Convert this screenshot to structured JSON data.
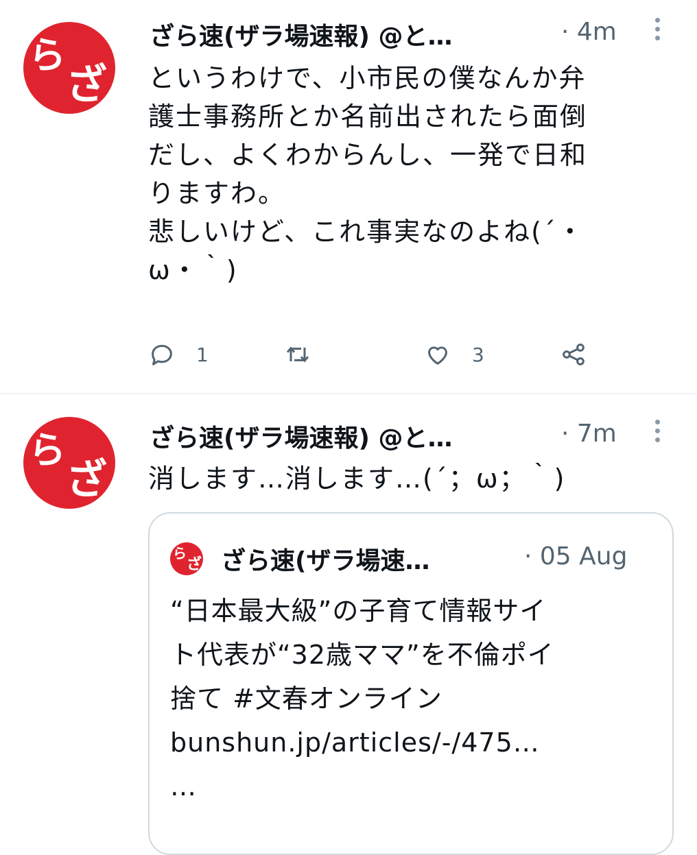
{
  "tweets": [
    {
      "avatar_chars": [
        "ら",
        "ざ"
      ],
      "name": "ざら速(ザラ場速報) @と…",
      "time": "· 4m",
      "body": "というわけで、小市民の僕なんか弁\n護士事務所とか名前出されたら面倒\nだし、よくわからんし、一発で日和\nりますわ。\n悲しいけど、これ事実なのよね(´・\nω・｀)",
      "actions": {
        "reply_count": "1",
        "retweet_count": "",
        "like_count": "3"
      }
    },
    {
      "avatar_chars": [
        "ら",
        "ざ"
      ],
      "name": "ざら速(ザラ場速報) @と…",
      "time": "· 7m",
      "body": "消します…消します…(´；ω；｀)",
      "quote": {
        "avatar_chars": [
          "ら",
          "ざ"
        ],
        "name": "ざら速(ザラ場速…",
        "time": "· 05 Aug",
        "lines": [
          "“日本最大級”の子育て情報サイ",
          "ト代表が“32歳ママ”を不倫ポイ",
          "捨て #文春オンライン",
          "bunshun.jp/articles/-/475…",
          "…"
        ]
      }
    }
  ],
  "colors": {
    "avatar_red": "#e0242f",
    "secondary_text": "#536471",
    "border": "#cfd9de"
  },
  "icons": [
    "reply-icon",
    "retweet-icon",
    "like-icon",
    "share-icon",
    "more-icon"
  ]
}
